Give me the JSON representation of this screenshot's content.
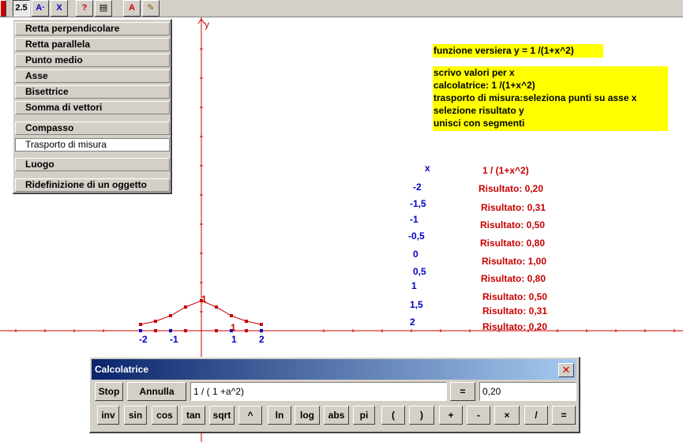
{
  "toolbar": {
    "buttons": [
      {
        "label": "2.5",
        "icon": "measure-icon"
      },
      {
        "label": "A·",
        "icon": "point-icon"
      },
      {
        "label": "X",
        "icon": "transform-icon"
      },
      {
        "label": "?",
        "icon": "query-icon"
      },
      {
        "label": "▤",
        "icon": "calculator-icon"
      },
      {
        "label": "A",
        "icon": "text-icon"
      },
      {
        "label": "✎",
        "icon": "brush-icon"
      }
    ]
  },
  "menu": {
    "items": [
      "Retta perpendicolare",
      "Retta parallela",
      "Punto medio",
      "Asse",
      "Bisettrice",
      "Somma di vettori",
      "Compasso",
      "Trasporto di misura",
      "Luogo",
      "Ridefinizione di un oggetto"
    ],
    "highlighted": "Trasporto di misura"
  },
  "axes": {
    "y_label": "y",
    "x_ticks": [
      "-2",
      "-1",
      "1",
      "2"
    ],
    "curve_peak_label": "1",
    "curve_point_label": "1"
  },
  "notes": {
    "title": "funzione versiera   y = 1 /(1+x^2)",
    "steps": [
      "scrivo valori per x",
      "calcolatrice: 1 /(1+x^2)",
      "trasporto di misura:seleziona punti su asse x",
      "selezione risultato y",
      "unisci con segmenti"
    ]
  },
  "table": {
    "x_header": "x",
    "y_header": "1 / (1+x^2)",
    "x_values": [
      "-2",
      "-1,5",
      "-1",
      "-0,5",
      "0",
      "0,5",
      "1",
      "1,5",
      "2"
    ],
    "results": [
      "Risultato: 0,20",
      "Risultato: 0,31",
      "Risultato: 0,50",
      "Risultato: 0,80",
      "Risultato: 1,00",
      "Risultato: 0,80",
      "Risultato: 0,50",
      "Risultato: 0,31",
      "Risultato: 0,20"
    ]
  },
  "calculator": {
    "title": "Calcolatrice",
    "close": "✕",
    "stop": "Stop",
    "cancel": "Annulla",
    "expression": "1 / ( 1 +a^2)",
    "equals_label": "=",
    "result": "0,20",
    "keys": [
      "inv",
      "sin",
      "cos",
      "tan",
      "sqrt",
      "^",
      "ln",
      "log",
      "abs",
      "pi",
      "(",
      ")",
      "+",
      "-",
      "×",
      "/",
      "="
    ]
  },
  "colors": {
    "axis": "#c80000",
    "x_values": "#0000c8",
    "results": "#c80000",
    "note_background": "#ffff00",
    "title_bar": "#0a246a"
  }
}
